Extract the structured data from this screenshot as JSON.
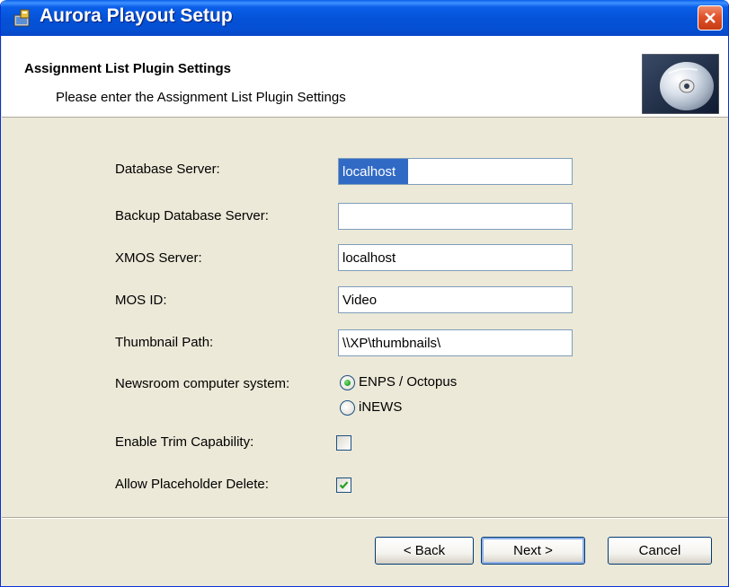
{
  "window": {
    "title": "Aurora Playout Setup"
  },
  "header": {
    "title": "Assignment List Plugin Settings",
    "subtitle": "Please enter the Assignment List Plugin Settings"
  },
  "form": {
    "database_server": {
      "label": "Database Server:",
      "value": "localhost",
      "selected": true
    },
    "backup_database_server": {
      "label": "Backup Database Server:",
      "value": ""
    },
    "xmos_server": {
      "label": "XMOS Server:",
      "value": "localhost"
    },
    "mos_id": {
      "label": "MOS ID:",
      "value": "Video"
    },
    "thumbnail_path": {
      "label": "Thumbnail Path:",
      "value": "\\\\XP\\thumbnails\\"
    },
    "newsroom_system": {
      "label": "Newsroom computer system:",
      "options": [
        {
          "label": "ENPS / Octopus",
          "selected": true
        },
        {
          "label": "iNEWS",
          "selected": false
        }
      ]
    },
    "enable_trim": {
      "label": "Enable Trim Capability:",
      "checked": false
    },
    "allow_placeholder_delete": {
      "label": "Allow Placeholder Delete:",
      "checked": true
    }
  },
  "buttons": {
    "back": "< Back",
    "next": "Next >",
    "cancel": "Cancel"
  },
  "colors": {
    "titlebar": "#0552d7",
    "dialog_background": "#ece9d8",
    "selection": "#316ac5",
    "close_button": "#e0522a"
  },
  "icons": [
    "installer-icon",
    "close-icon",
    "cd-disc-icon",
    "radio-dot-icon",
    "checkmark-icon"
  ]
}
